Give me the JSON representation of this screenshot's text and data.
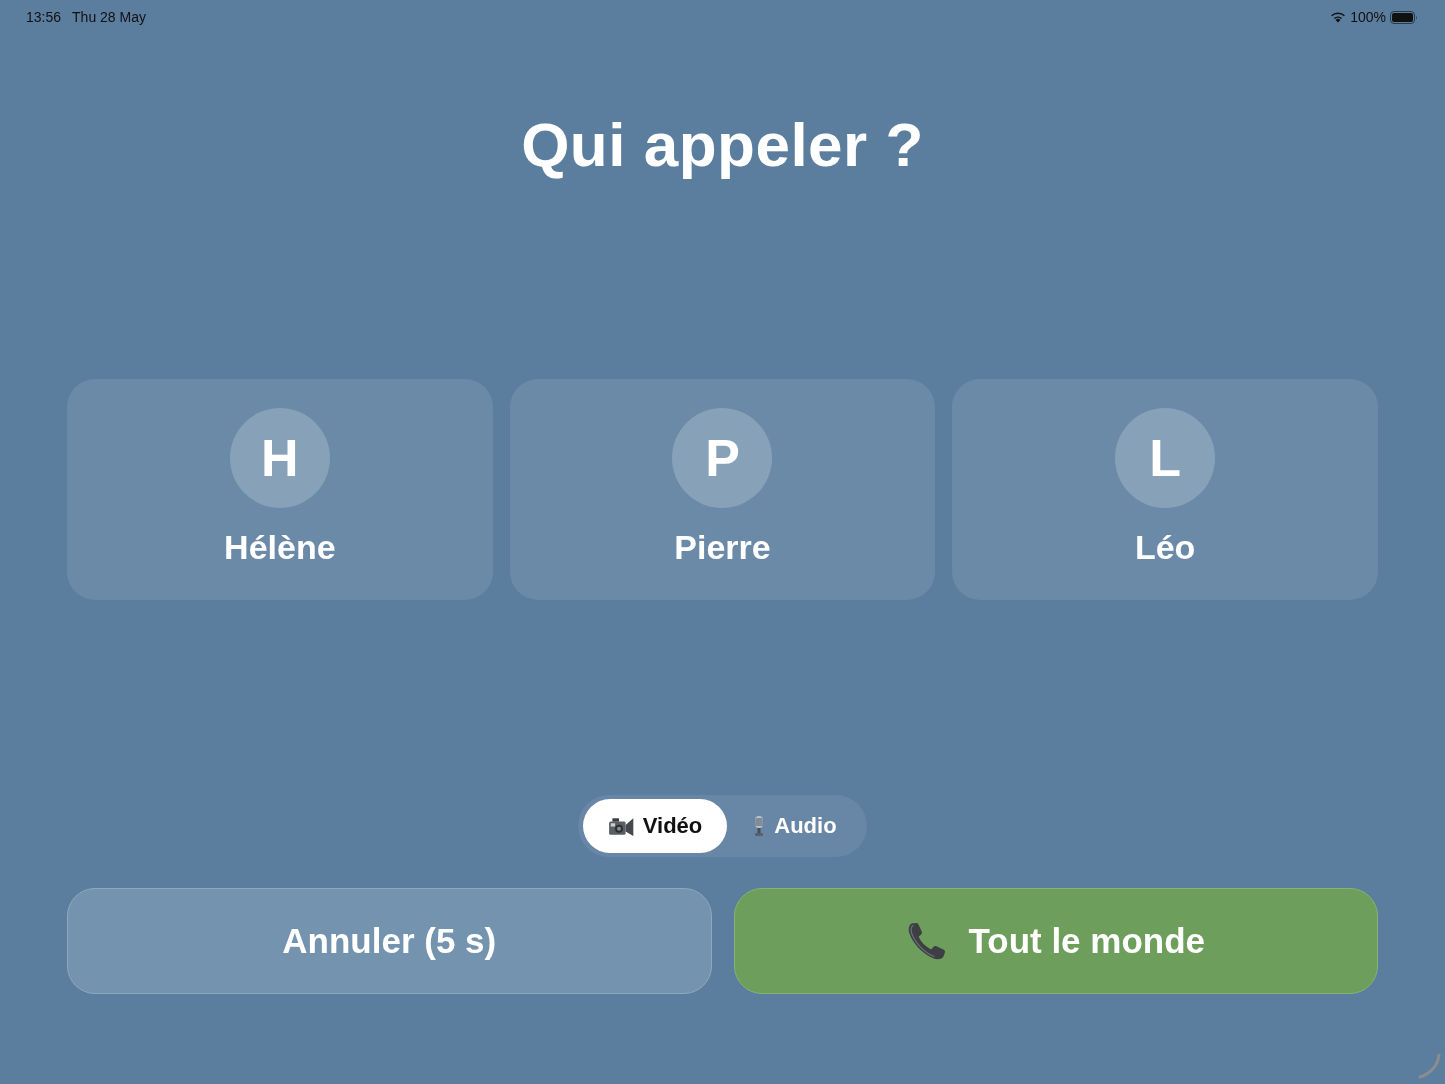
{
  "status_bar": {
    "time": "13:56",
    "date": "Thu 28 May",
    "battery": "100%"
  },
  "title": "Qui appeler ?",
  "contacts": [
    {
      "initial": "H",
      "name": "Hélène"
    },
    {
      "initial": "P",
      "name": "Pierre"
    },
    {
      "initial": "L",
      "name": "Léo"
    }
  ],
  "call_mode": [
    {
      "kind": "video",
      "label": "Vidéo",
      "selected": true
    },
    {
      "kind": "audio",
      "label": "Audio",
      "selected": false
    }
  ],
  "actions": [
    {
      "kind": "cancel",
      "label": "Annuler (5 s)"
    },
    {
      "kind": "call_all",
      "label": "Tout le monde"
    }
  ]
}
